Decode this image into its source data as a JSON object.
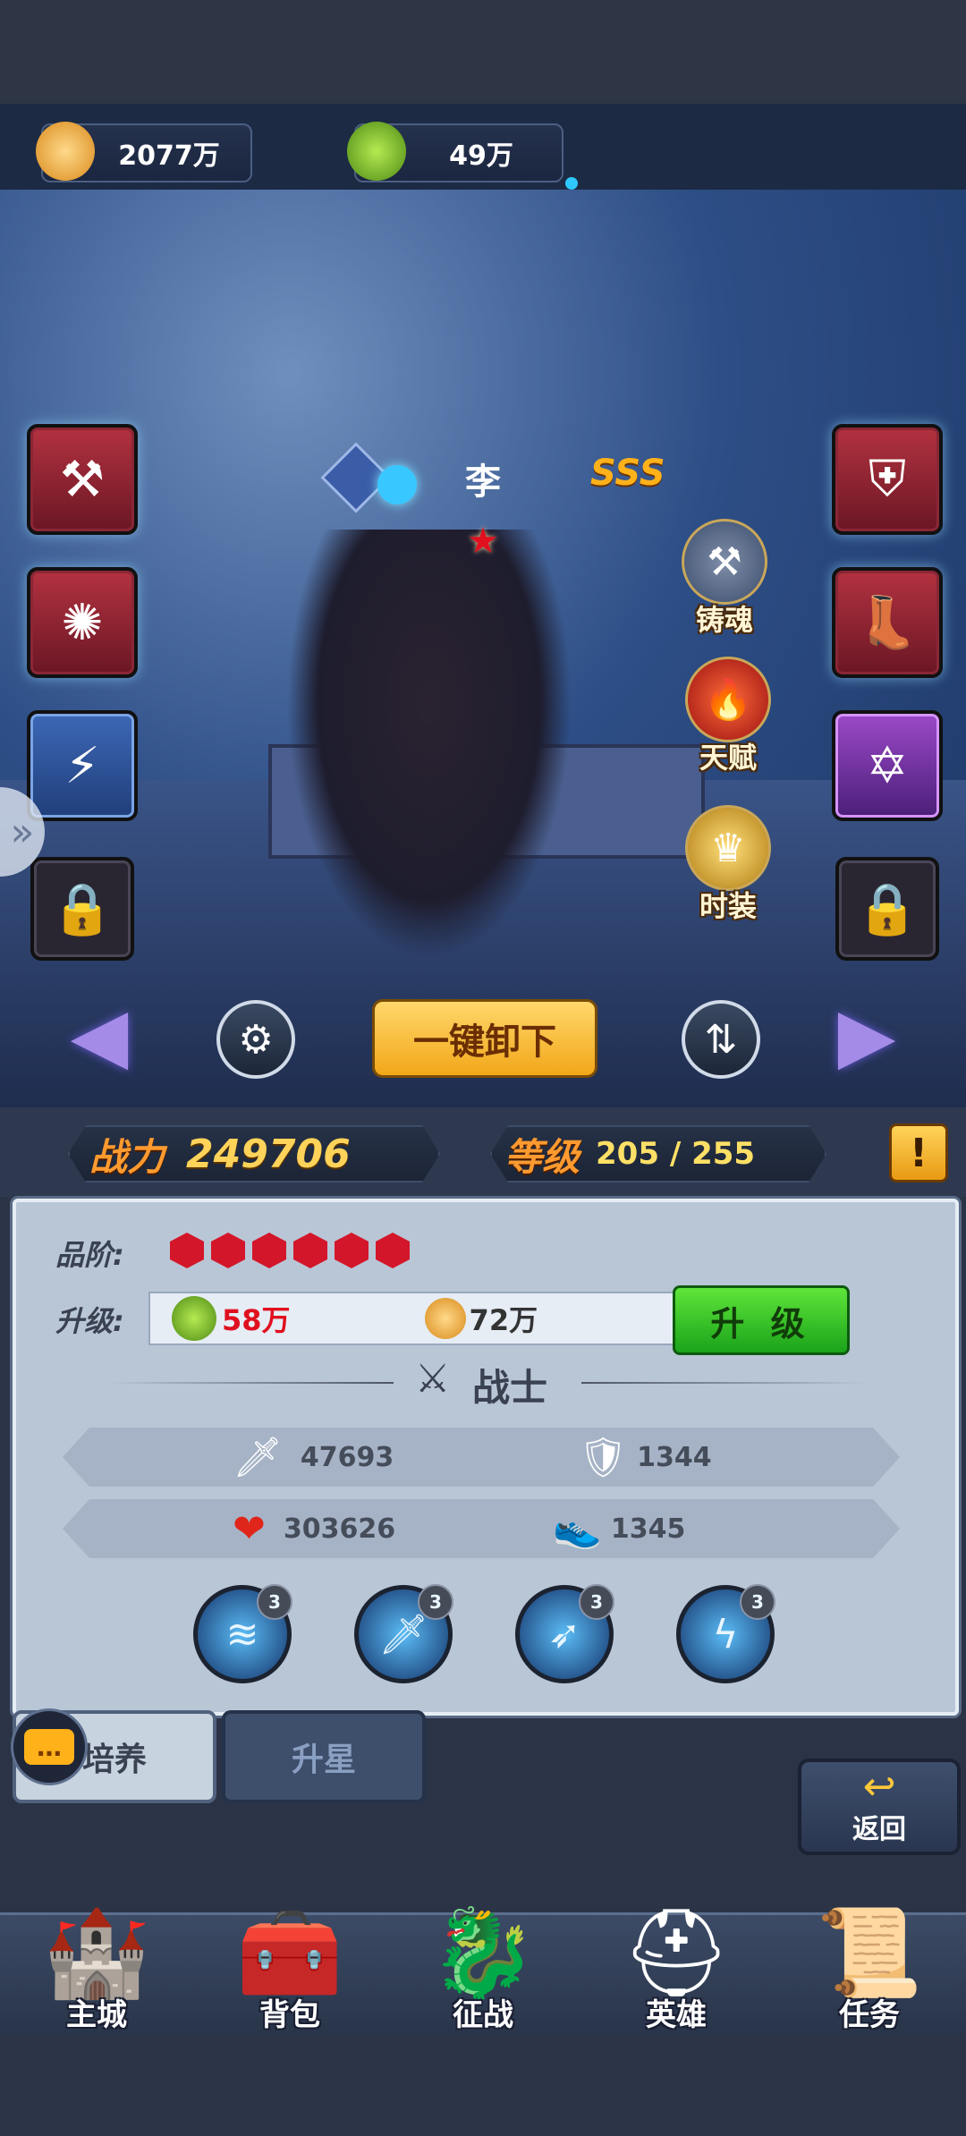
{
  "resources": {
    "gold": "2077万",
    "herb": "49万"
  },
  "hero": {
    "name": "李",
    "rank": "SSS",
    "stars": "★"
  },
  "side_buttons": {
    "forge_soul": "铸魂",
    "talent": "天赋",
    "costume": "时装"
  },
  "unequip_label": "一键卸下",
  "stats": {
    "power_label": "战力",
    "power_value": "249706",
    "level_label": "等级",
    "level_value": "205 / 255"
  },
  "panel": {
    "grade_label": "品阶:",
    "upgrade_label": "升级:",
    "cost_herb": "58万",
    "cost_gold": "72万",
    "upgrade_button": "升 级",
    "class_name": "战士",
    "attack": "47693",
    "defense": "1344",
    "hp": "303626",
    "speed": "1345",
    "skills": [
      {
        "level": "3"
      },
      {
        "level": "3"
      },
      {
        "level": "3"
      },
      {
        "level": "3"
      }
    ]
  },
  "tabs": {
    "train": "培养",
    "star_up": "升星"
  },
  "back_label": "返回",
  "nav": {
    "main_city": "主城",
    "bag": "背包",
    "campaign": "征战",
    "heroes": "英雄",
    "tasks": "任务"
  },
  "colors": {
    "accent_gold": "#f2a71a",
    "upgrade_green": "#1aa31a",
    "cost_red": "#e0101f"
  }
}
